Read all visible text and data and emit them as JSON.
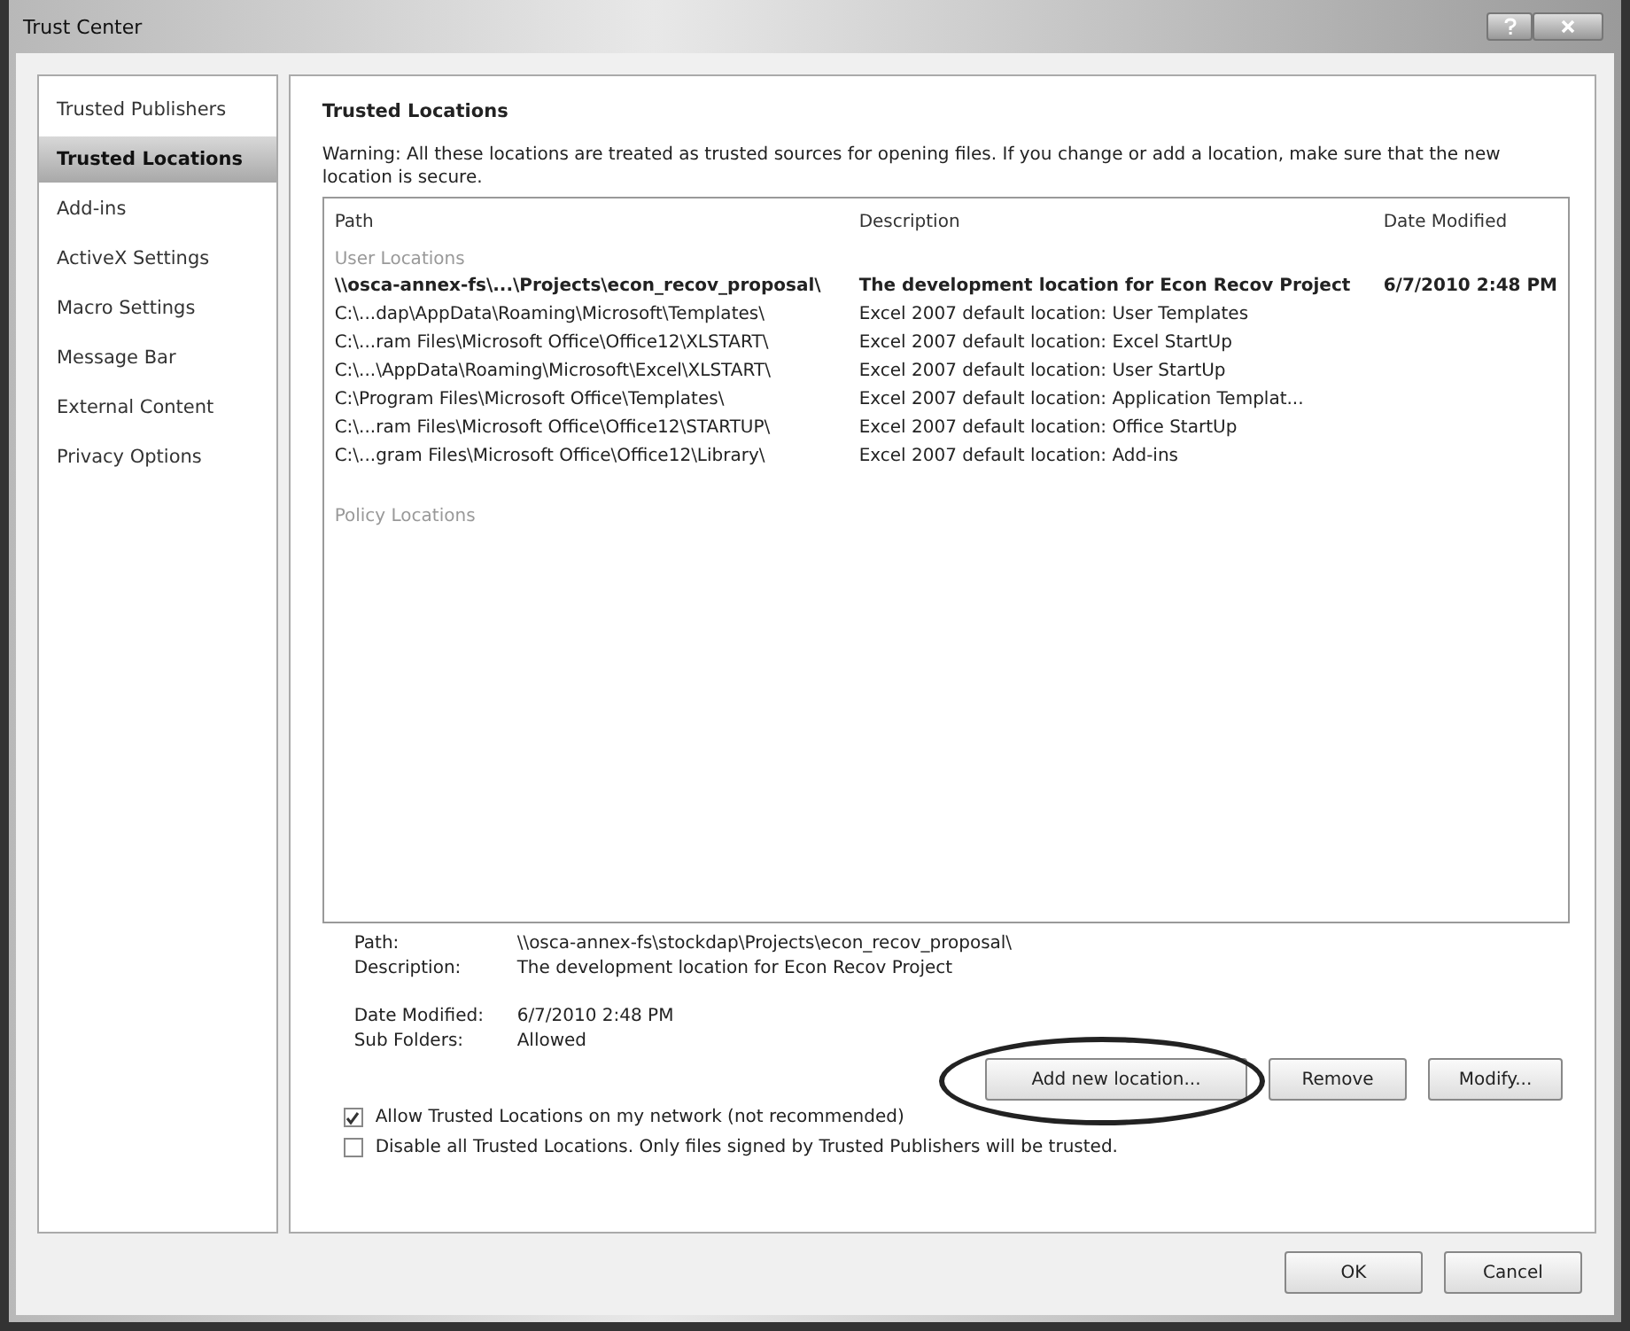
{
  "window": {
    "title": "Trust Center"
  },
  "sidebar": {
    "items": [
      {
        "label": "Trusted Publishers",
        "selected": false
      },
      {
        "label": "Trusted Locations",
        "selected": true
      },
      {
        "label": "Add-ins",
        "selected": false
      },
      {
        "label": "ActiveX Settings",
        "selected": false
      },
      {
        "label": "Macro Settings",
        "selected": false
      },
      {
        "label": "Message Bar",
        "selected": false
      },
      {
        "label": "External Content",
        "selected": false
      },
      {
        "label": "Privacy Options",
        "selected": false
      }
    ]
  },
  "section": {
    "title": "Trusted Locations",
    "warning": "Warning: All these locations are treated as trusted sources for opening files.  If you change or add a location, make sure that the new location is secure."
  },
  "table": {
    "columns": [
      "Path",
      "Description",
      "Date Modified"
    ],
    "groups": [
      {
        "label": "User Locations",
        "rows": [
          {
            "path": "\\\\osca-annex-fs\\...\\Projects\\econ_recov_proposal\\",
            "description": "The development location for Econ Recov Project",
            "date": "6/7/2010 2:48 PM",
            "selected": true
          },
          {
            "path": "C:\\...dap\\AppData\\Roaming\\Microsoft\\Templates\\",
            "description": "Excel 2007 default location: User Templates",
            "selected": false
          },
          {
            "path": "C:\\...ram Files\\Microsoft Office\\Office12\\XLSTART\\",
            "description": "Excel 2007 default location: Excel StartUp",
            "selected": false
          },
          {
            "path": "C:\\...\\AppData\\Roaming\\Microsoft\\Excel\\XLSTART\\",
            "description": "Excel 2007 default location: User StartUp",
            "selected": false
          },
          {
            "path": "C:\\Program Files\\Microsoft Office\\Templates\\",
            "description": "Excel 2007 default location: Application Templat...",
            "selected": false
          },
          {
            "path": "C:\\...ram Files\\Microsoft Office\\Office12\\STARTUP\\",
            "description": "Excel 2007 default location: Office StartUp",
            "selected": false
          },
          {
            "path": "C:\\...gram Files\\Microsoft Office\\Office12\\Library\\",
            "description": "Excel 2007 default location: Add-ins",
            "selected": false
          }
        ]
      },
      {
        "label": "Policy Locations"
      }
    ]
  },
  "details": [
    {
      "label": "Path:",
      "value": "\\\\osca-annex-fs\\stockdap\\Projects\\econ_recov_proposal\\"
    },
    {
      "label": "Description:",
      "value": "The development location for Econ Recov Project"
    },
    {
      "label": "Date Modified:",
      "value": "6/7/2010 2:48 PM"
    },
    {
      "label": "Sub Folders:",
      "value": "Allowed"
    }
  ],
  "actions": [
    "Add new location...",
    "Remove",
    "Modify..."
  ],
  "options": [
    {
      "label": "Allow Trusted Locations on my network (not recommended)",
      "checked": true
    },
    {
      "label": "Disable all Trusted Locations. Only files signed by Trusted Publishers will be trusted.",
      "checked": false
    }
  ],
  "buttons": [
    "OK",
    "Cancel"
  ]
}
